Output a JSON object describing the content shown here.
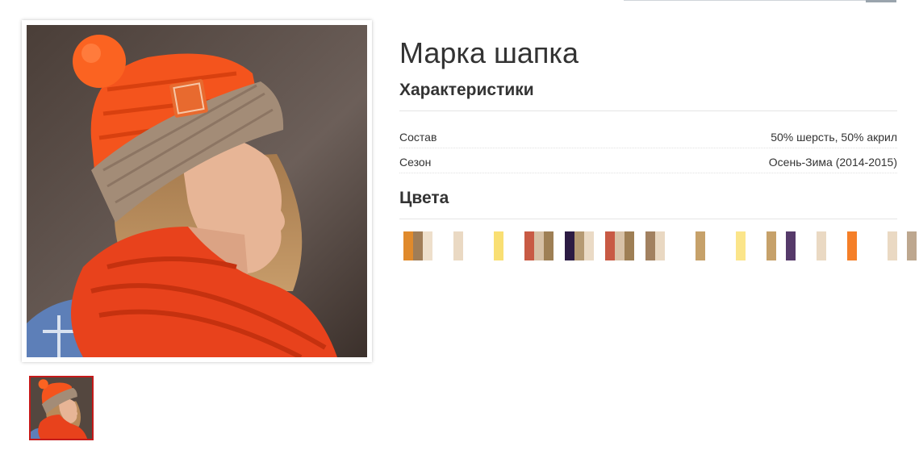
{
  "product": {
    "title": "Марка шапка",
    "characteristics_title": "Характеристики",
    "specs": [
      {
        "label": "Состав",
        "value": "50% шерсть, 50% акрил"
      },
      {
        "label": "Сезон",
        "value": "Осень-Зима (2014-2015)"
      }
    ],
    "colors_title": "Цвета",
    "color_swatches": [
      [
        "#e08a2c",
        "#a07d57",
        "#eedfcb"
      ],
      [
        "#ffffff",
        "#ead9c3",
        "#ffffff"
      ],
      [
        "#ffffff",
        "#f9df73",
        "#ffffff"
      ],
      [
        "#c85a44",
        "#d6c0a5",
        "#9e7f55"
      ],
      [
        "#2c1b43",
        "#b59a73",
        "#eadac5"
      ],
      [
        "#c85a44",
        "#d8c2a7",
        "#9e7f55"
      ],
      [
        "#a28160",
        "#e9d8c2",
        "#ffffff"
      ],
      [
        "#ffffff",
        "#c6a16a",
        "#ffffff"
      ],
      [
        "#ffffff",
        "#fbe58a",
        "#ffffff"
      ],
      [
        "#c6a16a",
        "#ffffff",
        "#563a6a"
      ],
      [
        "#ffffff",
        "#ead9c3",
        "#ffffff"
      ],
      [
        "#f57f28",
        "#ffffff",
        "#ffffff"
      ],
      [
        "#ead9c3",
        "#ffffff",
        "#bda78f"
      ]
    ]
  },
  "images": {
    "main_alt": "hat-photo",
    "thumbnail_selected": true
  },
  "colors": {
    "thumb_border": "#c41a1a",
    "search_button": "#9aa4ad"
  }
}
